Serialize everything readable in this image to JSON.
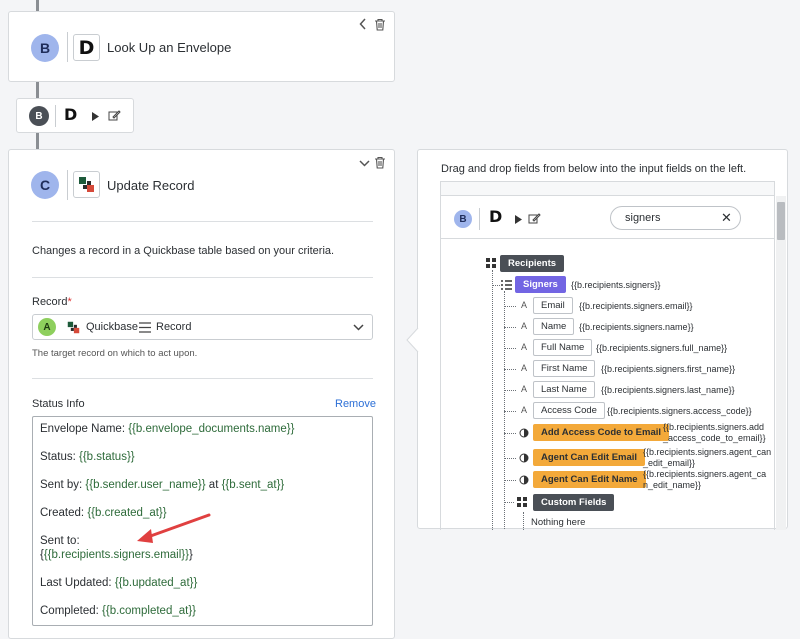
{
  "step1": {
    "badge": "B",
    "app_letter": "D",
    "title": "Look Up an Envelope"
  },
  "step_mini": {
    "badge": "B",
    "app_letter": "D"
  },
  "step2": {
    "badge": "C",
    "title": "Update Record",
    "description": "Changes a record in a Quickbase table based on your criteria.",
    "record_label": "Record",
    "required_mark": "*",
    "record_select": {
      "badge": "A",
      "app_name": "Quickbase",
      "object_name": "Record"
    },
    "record_help": "The target record on which to act upon.",
    "status_label": "Status Info",
    "remove_label": "Remove",
    "status_lines": [
      {
        "label": "Envelope Name: ",
        "token": "{{b.envelope_documents.name}}"
      },
      {
        "label": "Status: ",
        "token": "{{b.status}}"
      },
      {
        "label": "Sent by: ",
        "token": "{{b.sender.user_name}}",
        "mid": " at ",
        "token2": "{{b.sent_at}}"
      },
      {
        "label": "Created: ",
        "token": "{{b.created_at}}"
      },
      {
        "label": "Sent to:",
        "token": ""
      },
      {
        "label": "",
        "token": "{{b.recipients.signers.email}}"
      },
      {
        "label": "Last Updated: ",
        "token": "{{b.updated_at}}"
      },
      {
        "label": "Completed:  ",
        "token": "{{b.completed_at}}"
      }
    ]
  },
  "drag_panel": {
    "hint": "Drag and drop fields from below into the input fields on the left.",
    "badge": "B",
    "app_letter": "D",
    "search_value": "signers",
    "recipients_label": "Recipients",
    "signers": {
      "label": "Signers",
      "path": "{{b.recipients.signers}}"
    },
    "fields": [
      {
        "type": "A",
        "label": "Email",
        "path": "{{b.recipients.signers.email}}",
        "style": "plain"
      },
      {
        "type": "A",
        "label": "Name",
        "path": "{{b.recipients.signers.name}}",
        "style": "plain"
      },
      {
        "type": "A",
        "label": "Full Name",
        "path": "{{b.recipients.signers.full_name}}",
        "style": "plain"
      },
      {
        "type": "A",
        "label": "First Name",
        "path": "{{b.recipients.signers.first_name}}",
        "style": "plain"
      },
      {
        "type": "A",
        "label": "Last Name",
        "path": "{{b.recipients.signers.last_name}}",
        "style": "plain"
      },
      {
        "type": "A",
        "label": "Access Code",
        "path": "{{b.recipients.signers.access_code}}",
        "style": "plain"
      },
      {
        "type": "bool",
        "label": "Add Access Code to Email",
        "path1": "{{b.recipients.signers.add",
        "path2": "_access_code_to_email}}",
        "style": "orange"
      },
      {
        "type": "bool",
        "label": "Agent Can Edit Email",
        "path1": "{{b.recipients.signers.agent_can",
        "path2": "_edit_email}}",
        "style": "orange"
      },
      {
        "type": "bool",
        "label": "Agent Can Edit Name",
        "path1": "{{b.recipients.signers.agent_ca",
        "path2": "n_edit_name}}",
        "style": "orange"
      }
    ],
    "custom_fields_label": "Custom Fields",
    "nothing_here": "Nothing here"
  },
  "colors": {
    "accent_link": "#2c6fd6",
    "badge_blue": "#9fb5ec",
    "orange_chip": "#f3a93a",
    "purple_chip": "#7265e3",
    "arrow_red": "#e04040"
  }
}
